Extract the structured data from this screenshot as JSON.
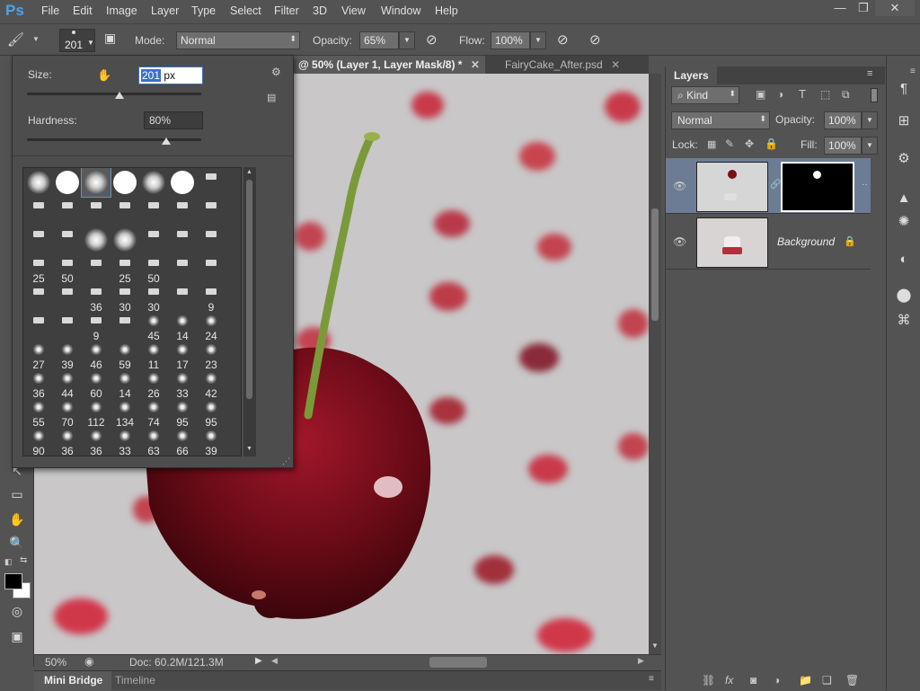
{
  "menu": {
    "items": [
      "File",
      "Edit",
      "Image",
      "Layer",
      "Type",
      "Select",
      "Filter",
      "3D",
      "View",
      "Window",
      "Help"
    ],
    "logo": "Ps"
  },
  "window_controls": {
    "minimize": "—",
    "restore": "❐",
    "close": "✕"
  },
  "options": {
    "brush_size": "201",
    "mode_label": "Mode:",
    "mode_value": "Normal",
    "opacity_label": "Opacity:",
    "opacity_value": "65%",
    "flow_label": "Flow:",
    "flow_value": "100%"
  },
  "tabs": [
    {
      "label": "@ 50% (Layer 1, Layer Mask/8) *"
    },
    {
      "label": "FairyCake_After.psd"
    }
  ],
  "brush_picker": {
    "size_label": "Size:",
    "size_value": "201",
    "size_unit": "px",
    "hardness_label": "Hardness:",
    "hardness_value": "80%",
    "size_level": 0.53,
    "hardness_level": 0.8,
    "presets": [
      [
        "soft",
        "hard",
        "soft",
        "hard",
        "soft",
        "hard",
        "i:"
      ],
      [
        "i:",
        "i:",
        "i:",
        "i:",
        "i:",
        "i:",
        "i:"
      ],
      [
        "i:",
        "i:",
        "soft",
        "soft",
        "i:",
        "i:",
        "i:"
      ],
      [
        "i:25",
        "i:50",
        "i:",
        "i:25",
        "i:50",
        "i:",
        "i:"
      ],
      [
        "i:",
        "i:",
        "i:36",
        "i:30",
        "i:30",
        "i:",
        "i:9"
      ],
      [
        "i:",
        "i:",
        "i:9",
        "i:",
        "s:45",
        "s:14",
        "s:24"
      ],
      [
        "s:27",
        "s:39",
        "s:46",
        "s:59",
        "s:11",
        "s:17",
        "s:23"
      ],
      [
        "s:36",
        "s:44",
        "s:60",
        "s:14",
        "s:26",
        "s:33",
        "s:42"
      ],
      [
        "s:55",
        "s:70",
        "s:112",
        "s:134",
        "s:74",
        "s:95",
        "s:95"
      ],
      [
        "s:90",
        "s:36",
        "s:36",
        "s:33",
        "s:63",
        "s:66",
        "s:39"
      ]
    ]
  },
  "status": {
    "zoom": "50%",
    "doc": "Doc: 60.2M/121.3M"
  },
  "bottom_tabs": [
    "Mini Bridge",
    "Timeline"
  ],
  "layers": {
    "title": "Layers",
    "filter": "Kind",
    "blend": "Normal",
    "opacity_label": "Opacity:",
    "opacity": "100%",
    "lock_label": "Lock:",
    "fill_label": "Fill:",
    "fill": "100%",
    "items": [
      {
        "name": ""
      },
      {
        "name": "Background"
      }
    ]
  },
  "colors": {
    "accent": "#4fa3e8",
    "canvas": "#c9c7c8",
    "cherry": "#7a0f1a",
    "dots": "#c83a4a"
  }
}
